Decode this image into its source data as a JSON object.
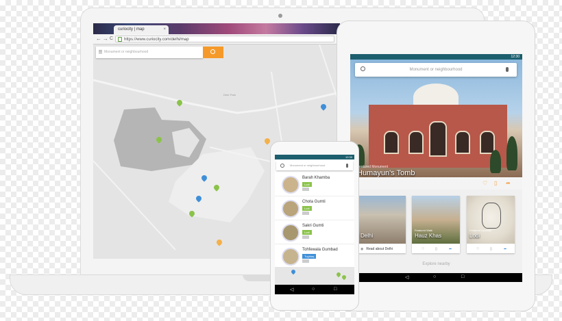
{
  "colors": {
    "accent": "#f59a2a",
    "status": "#1d5f6e",
    "badge_green": "#8bc34a",
    "badge_blue": "#3f8fd8",
    "pin_green": "#8bc34a",
    "pin_blue": "#3f8fd8",
    "pin_orange": "#f5b04a"
  },
  "browser": {
    "tab_title": "curiocity | map",
    "tab_close": "×",
    "url": "https://www.curiocity.com/delhi/map",
    "back": "←",
    "forward": "→",
    "reload": "C",
    "more": "⋮"
  },
  "map": {
    "search_placeholder": "Monument or neighbourhood",
    "area_label": "Deer Park"
  },
  "tablet": {
    "status_time": "12:30",
    "search_placeholder": "Monument or neighbourhood",
    "hero_kicker": "Featured Monument",
    "hero_title": "Humayun's Tomb",
    "explore": "Explore nearby",
    "cards": [
      {
        "kicker": "",
        "title": "Delhi",
        "footer": "Read about Delhi"
      },
      {
        "kicker": "Featured Walk",
        "title": "Hauz Khas",
        "footer": ""
      },
      {
        "kicker": "Featured Dynasty",
        "title": "Lodi",
        "footer": ""
      }
    ]
  },
  "phone": {
    "status_time": "12:30",
    "search_placeholder": "Monument or neighbourhood",
    "items": [
      {
        "title": "Barah Khamba",
        "badge": "Lodi",
        "badge_color": "#8bc34a"
      },
      {
        "title": "Chota Gumti",
        "badge": "Lodi",
        "badge_color": "#8bc34a"
      },
      {
        "title": "Sakri Gumti",
        "badge": "Lodi",
        "badge_color": "#8bc34a"
      },
      {
        "title": "Tohfewala Gumbad",
        "badge": "Tughlaq",
        "badge_color": "#3f8fd8"
      }
    ]
  },
  "icons": {
    "search": "search-icon",
    "mic": "mic-icon",
    "heart": "heart-icon",
    "bookmark": "bookmark-icon",
    "share": "share-icon"
  }
}
